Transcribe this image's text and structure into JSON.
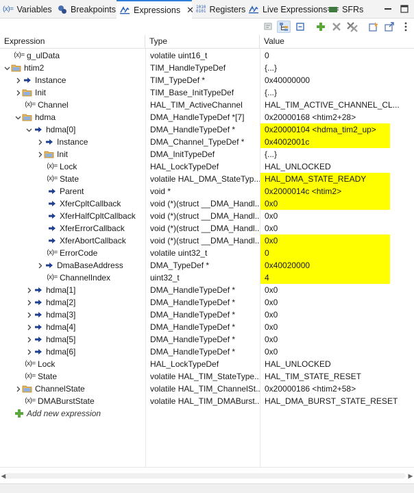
{
  "tabs": [
    {
      "label": "Variables",
      "icon": "variables-icon"
    },
    {
      "label": "Breakpoints",
      "icon": "breakpoints-icon"
    },
    {
      "label": "Expressions",
      "icon": "expressions-icon",
      "active": true
    },
    {
      "label": "Registers",
      "icon": "registers-icon"
    },
    {
      "label": "Live Expressions",
      "icon": "live-expressions-icon"
    },
    {
      "label": "SFRs",
      "icon": "sfrs-icon"
    }
  ],
  "icons": {
    "registers_glyph": "1010\n0101",
    "expression_glyph": "(x)=",
    "tab_variables_glyph": "(x)="
  },
  "columns": {
    "expression": "Expression",
    "type": "Type",
    "value": "Value"
  },
  "rows": [
    {
      "name": "g_ulData",
      "type": "volatile uint16_t",
      "value": "0"
    },
    {
      "name": "htim2",
      "type": "TIM_HandleTypeDef",
      "value": "{...}"
    },
    {
      "name": "Instance",
      "type": "TIM_TypeDef *",
      "value": "0x40000000"
    },
    {
      "name": "Init",
      "type": "TIM_Base_InitTypeDef",
      "value": "{...}"
    },
    {
      "name": "Channel",
      "type": "HAL_TIM_ActiveChannel",
      "value": "HAL_TIM_ACTIVE_CHANNEL_CL..."
    },
    {
      "name": "hdma",
      "type": "DMA_HandleTypeDef *[7]",
      "value": "0x20000168 <htim2+28>"
    },
    {
      "name": "hdma[0]",
      "type": "DMA_HandleTypeDef *",
      "value": "0x20000104 <hdma_tim2_up>"
    },
    {
      "name": "Instance",
      "type": "DMA_Channel_TypeDef *",
      "value": "0x4002001c"
    },
    {
      "name": "Init",
      "type": "DMA_InitTypeDef",
      "value": "{...}"
    },
    {
      "name": "Lock",
      "type": "HAL_LockTypeDef",
      "value": "HAL_UNLOCKED"
    },
    {
      "name": "State",
      "type": "volatile HAL_DMA_StateTyp...",
      "value": "HAL_DMA_STATE_READY"
    },
    {
      "name": "Parent",
      "type": "void *",
      "value": "0x2000014c <htim2>"
    },
    {
      "name": "XferCpltCallback",
      "type": "void (*)(struct __DMA_Handl...",
      "value": "0x0"
    },
    {
      "name": "XferHalfCpltCallback",
      "type": "void (*)(struct __DMA_Handl...",
      "value": "0x0"
    },
    {
      "name": "XferErrorCallback",
      "type": "void (*)(struct __DMA_Handl...",
      "value": "0x0"
    },
    {
      "name": "XferAbortCallback",
      "type": "void (*)(struct __DMA_Handl...",
      "value": "0x0"
    },
    {
      "name": "ErrorCode",
      "type": "volatile uint32_t",
      "value": "0"
    },
    {
      "name": "DmaBaseAddress",
      "type": "DMA_TypeDef *",
      "value": "0x40020000"
    },
    {
      "name": "ChannelIndex",
      "type": "uint32_t",
      "value": "4"
    },
    {
      "name": "hdma[1]",
      "type": "DMA_HandleTypeDef *",
      "value": "0x0"
    },
    {
      "name": "hdma[2]",
      "type": "DMA_HandleTypeDef *",
      "value": "0x0"
    },
    {
      "name": "hdma[3]",
      "type": "DMA_HandleTypeDef *",
      "value": "0x0"
    },
    {
      "name": "hdma[4]",
      "type": "DMA_HandleTypeDef *",
      "value": "0x0"
    },
    {
      "name": "hdma[5]",
      "type": "DMA_HandleTypeDef *",
      "value": "0x0"
    },
    {
      "name": "hdma[6]",
      "type": "DMA_HandleTypeDef *",
      "value": "0x0"
    },
    {
      "name": "Lock",
      "type": "HAL_LockTypeDef",
      "value": "HAL_UNLOCKED"
    },
    {
      "name": "State",
      "type": "volatile HAL_TIM_StateType...",
      "value": "HAL_TIM_STATE_RESET"
    },
    {
      "name": "ChannelState",
      "type": "volatile HAL_TIM_ChannelSt...",
      "value": "0x20000186 <htim2+58>"
    },
    {
      "name": "DMABurstState",
      "type": "volatile HAL_TIM_DMABurst...",
      "value": "HAL_DMA_BURST_STATE_RESET"
    }
  ],
  "add_expression_label": "Add new expression",
  "colors": {
    "highlight": "#ffff00",
    "accent": "#2f7ed8"
  }
}
